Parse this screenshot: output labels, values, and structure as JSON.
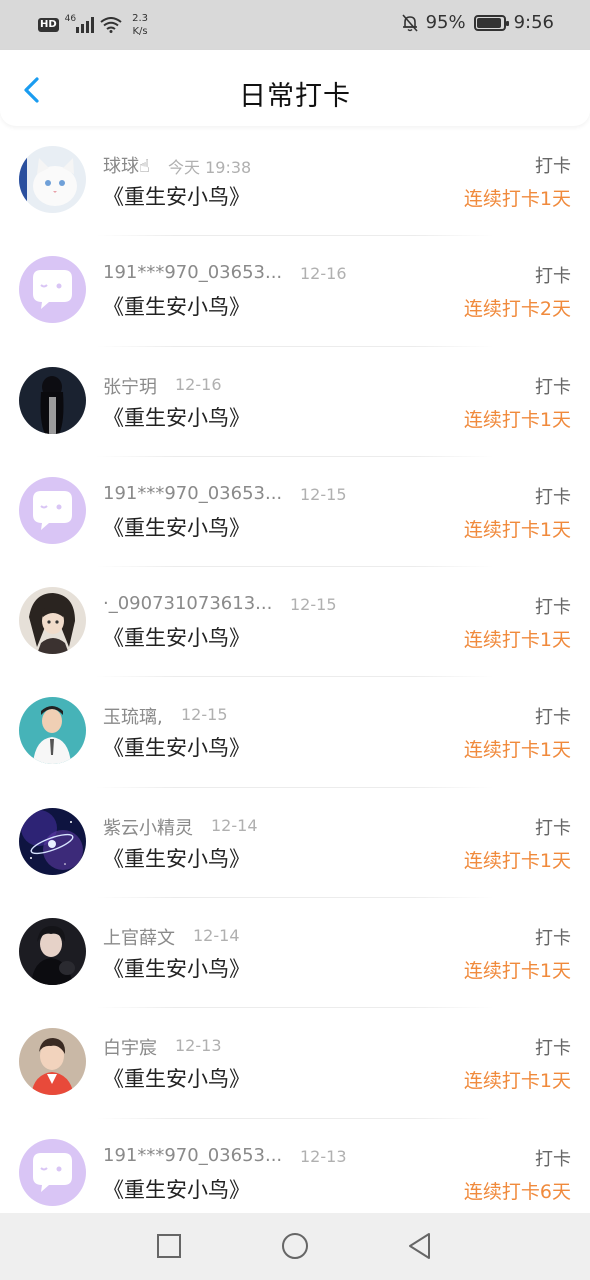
{
  "status_bar": {
    "network": "46",
    "speed_value": "2.3",
    "speed_unit": "K/s",
    "battery": "95%",
    "battery_level": 0.95,
    "time": "9:56"
  },
  "header": {
    "title": "日常打卡"
  },
  "items": [
    {
      "name": "球球",
      "name_emoji": "☝",
      "date": "今天 19:38",
      "book": "《重生安小鸟》",
      "action": "打卡",
      "streak": "连续打卡1天",
      "avatar": "cat"
    },
    {
      "name": "191***970_03653...",
      "date": "12-16",
      "book": "《重生安小鸟》",
      "action": "打卡",
      "streak": "连续打卡2天",
      "avatar": "default"
    },
    {
      "name": "张宁玥",
      "date": "12-16",
      "book": "《重生安小鸟》",
      "action": "打卡",
      "streak": "连续打卡1天",
      "avatar": "dark"
    },
    {
      "name": "191***970_03653...",
      "date": "12-15",
      "book": "《重生安小鸟》",
      "action": "打卡",
      "streak": "连续打卡1天",
      "avatar": "default"
    },
    {
      "name": "·_090731073613...",
      "date": "12-15",
      "book": "《重生安小鸟》",
      "action": "打卡",
      "streak": "连续打卡1天",
      "avatar": "anime"
    },
    {
      "name": "玉琉璃,",
      "date": "12-15",
      "book": "《重生安小鸟》",
      "action": "打卡",
      "streak": "连续打卡1天",
      "avatar": "teal"
    },
    {
      "name": "紫云小精灵",
      "date": "12-14",
      "book": "《重生安小鸟》",
      "action": "打卡",
      "streak": "连续打卡1天",
      "avatar": "galaxy"
    },
    {
      "name": "上官薛文",
      "date": "12-14",
      "book": "《重生安小鸟》",
      "action": "打卡",
      "streak": "连续打卡1天",
      "avatar": "dark2"
    },
    {
      "name": "白宇宸",
      "date": "12-13",
      "book": "《重生安小鸟》",
      "action": "打卡",
      "streak": "连续打卡1天",
      "avatar": "boy"
    },
    {
      "name": "191***970_03653...",
      "date": "12-13",
      "book": "《重生安小鸟》",
      "action": "打卡",
      "streak": "连续打卡6天",
      "avatar": "default"
    }
  ],
  "icons": {
    "back": "chevron-left-icon",
    "nav": [
      "square-recent-icon",
      "circle-home-icon",
      "triangle-back-icon"
    ]
  },
  "colors": {
    "accent_blue": "#1a9cf0",
    "streak_orange": "#f08a3c",
    "default_avatar": "#d9c5f5"
  }
}
